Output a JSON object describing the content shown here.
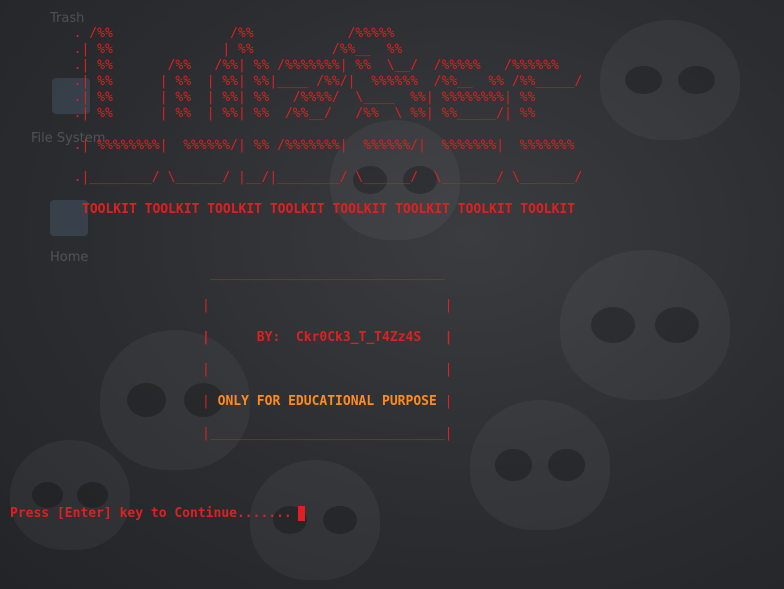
{
  "desktop": {
    "icons": [
      {
        "label": "Trash",
        "icon": "trash-icon"
      },
      {
        "label": "File System",
        "icon": "drive-icon"
      },
      {
        "label": "Home",
        "icon": "home-folder-icon"
      }
    ]
  },
  "terminal": {
    "banner_lines": [
      "  . /%%               /%%            /%%%%%",
      "  .| %%              | %%          /%%__  %%",
      "  .| %%       /%%   /%%| %% /%%%%%%%| %%  \\__/  /%%%%%   /%%%%%%",
      "  .| %%      | %%  | %%| %%|____ /%%/|  %%%%%%  /%%__  %% /%%_____/",
      "  .| %%      | %%  | %%| %%   /%%%%/  \\____  %%| %%%%%%%%| %%",
      "  .| %%      | %%  | %%| %%  /%%__/   /%%  \\ %%| %%_____/| %%",
      "  .| %%%%%%%%|  %%%%%%/| %% /%%%%%%%|  %%%%%%/|  %%%%%%%|  %%%%%%%",
      "  .|________/ \\______/ |__/|________/ \\______/  \\_______/ \\_______/"
    ],
    "toolkit_line": "TOOLKIT TOOLKIT TOOLKIT TOOLKIT TOOLKIT TOOLKIT TOOLKIT TOOLKIT",
    "box": {
      "top": "______________________________",
      "side_empty": "|                              |",
      "author_line": "|      BY:  Ckr0Ck3_T_T4Zz4S   |",
      "purpose_left": "|",
      "purpose_text": " ONLY FOR EDUCATIONAL PURPOSE ",
      "purpose_right": "|",
      "bottom": "|______________________________|"
    },
    "prompt": "Press [Enter] key to Continue......."
  }
}
